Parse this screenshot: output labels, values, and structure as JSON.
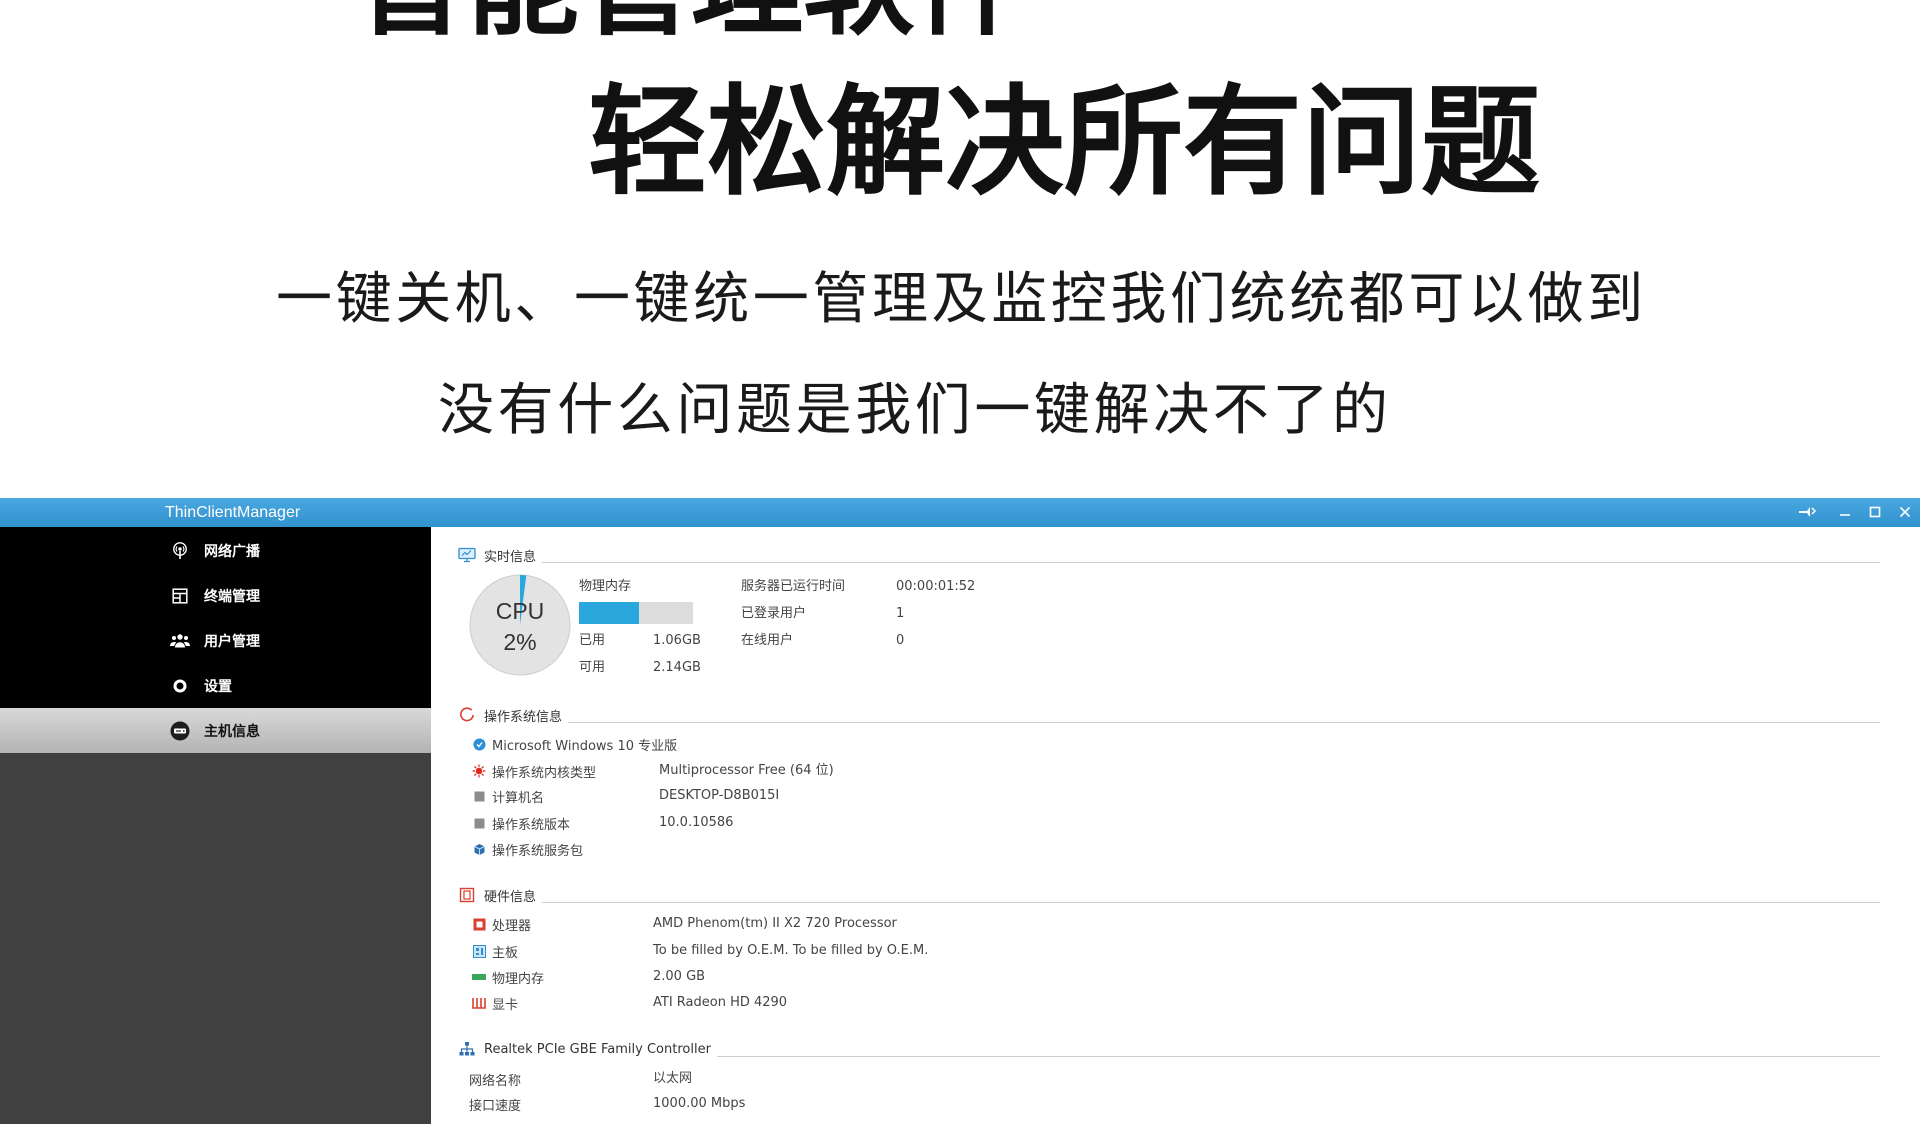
{
  "promo": {
    "headline_top": "智能管理软件",
    "headline": "轻松解决所有问题",
    "tagline_1": "一键关机、一键统一管理及监控我们统统都可以做到",
    "tagline_2": "没有什么问题是我们一键解决不了的"
  },
  "window": {
    "title": "ThinClientManager",
    "controls": [
      "tool-icon",
      "minimize-icon",
      "maximize-icon",
      "close-icon"
    ]
  },
  "sidebar": {
    "items": [
      {
        "label": "网络广播",
        "icon": "broadcast-icon"
      },
      {
        "label": "终端管理",
        "icon": "terminal-grid-icon"
      },
      {
        "label": "用户管理",
        "icon": "users-icon"
      },
      {
        "label": "设置",
        "icon": "settings-ring-icon"
      },
      {
        "label": "主机信息",
        "icon": "host-info-icon",
        "selected": true
      }
    ]
  },
  "realtime": {
    "title": "实时信息",
    "icon": "monitor-icon",
    "cpu": {
      "label": "CPU",
      "value": "2%",
      "percent": 2
    },
    "memory": {
      "label": "物理内存",
      "used_label": "已用",
      "used": "1.06GB",
      "free_label": "可用",
      "free": "2.14GB",
      "used_fraction": 0.53
    },
    "stats": [
      {
        "label": "服务器已运行时间",
        "value": "00:00:01:52"
      },
      {
        "label": "已登录用户",
        "value": "1"
      },
      {
        "label": "在线用户",
        "value": "0"
      }
    ]
  },
  "os": {
    "title": "操作系统信息",
    "icon": "os-ring-icon",
    "rows": [
      {
        "label": "Microsoft Windows 10 专业版",
        "icon": "windows-badge-icon"
      },
      {
        "label": "操作系统内核类型",
        "value": "Multiprocessor Free (64 位)",
        "icon": "kernel-icon"
      },
      {
        "label": "计算机名",
        "value": "DESKTOP-D8B015I",
        "icon": "computer-name-icon"
      },
      {
        "label": "操作系统版本",
        "value": "10.0.10586",
        "icon": "os-version-icon"
      },
      {
        "label": "操作系统服务包",
        "icon": "service-pack-icon"
      }
    ]
  },
  "hardware": {
    "title": "硬件信息",
    "icon": "chip-icon",
    "rows": [
      {
        "label": "处理器",
        "value": "AMD Phenom(tm) II X2 720 Processor",
        "icon": "processor-icon"
      },
      {
        "label": "主板",
        "value": "To be filled by O.E.M. To be filled by O.E.M.",
        "icon": "mainboard-icon"
      },
      {
        "label": "物理内存",
        "value": "2.00 GB",
        "icon": "memory-icon"
      },
      {
        "label": "显卡",
        "value": "ATI Radeon HD 4290",
        "icon": "graphics-card-icon"
      }
    ]
  },
  "network": {
    "title": "Realtek PCIe GBE Family Controller",
    "icon": "network-icon",
    "rows": [
      {
        "label": "网络名称",
        "value": "以太网"
      },
      {
        "label": "接口速度",
        "value": "1000.00 Mbps"
      }
    ]
  },
  "colors": {
    "titlebar": "#3a9ad6",
    "sidebar_top": "#000000",
    "sidebar_bottom": "#404040",
    "sidebar_selected": "#c4c4c4",
    "accent_blue": "#2aa8de",
    "icon_red": "#d8402f",
    "gauge_fill": "#e3e3e3"
  }
}
